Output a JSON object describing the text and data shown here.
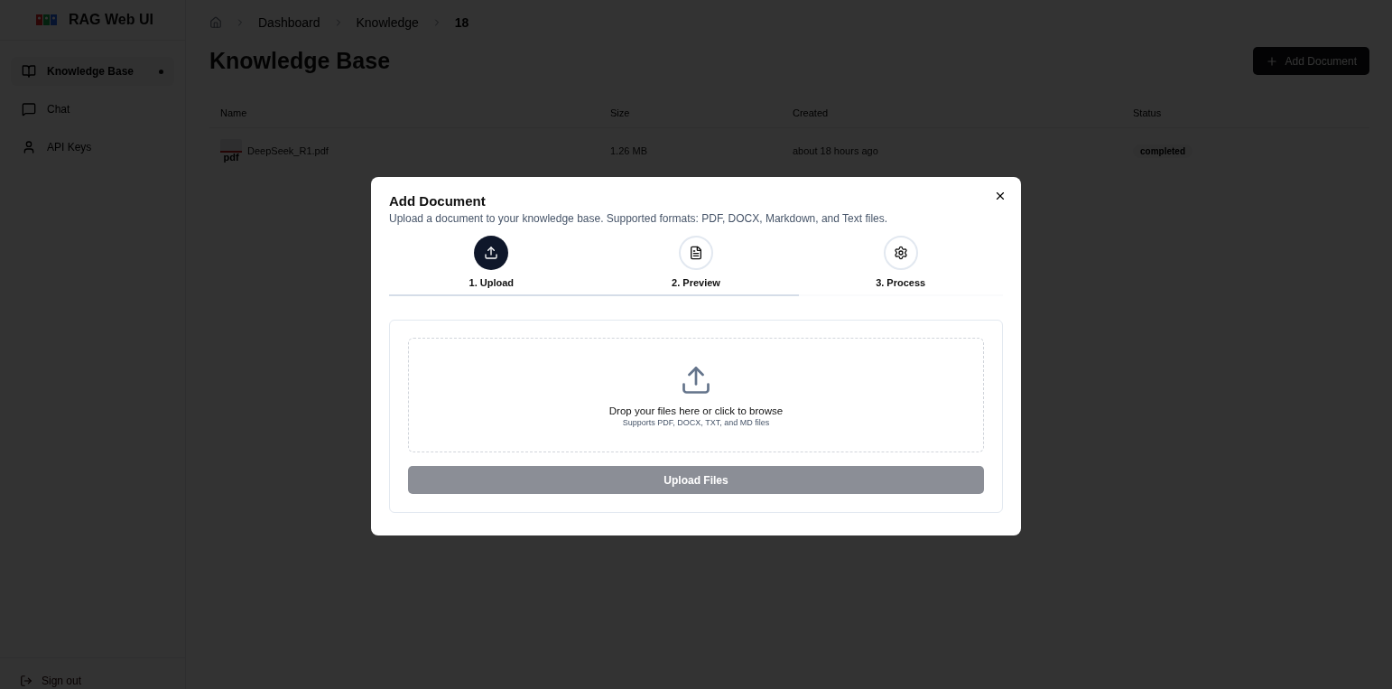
{
  "app": {
    "title": "RAG Web UI"
  },
  "sidebar": {
    "items": [
      {
        "label": "Knowledge Base",
        "selected": true
      },
      {
        "label": "Chat",
        "selected": false
      },
      {
        "label": "API Keys",
        "selected": false
      }
    ],
    "sign_out": "Sign out"
  },
  "breadcrumb": [
    {
      "label": "Dashboard",
      "current": false
    },
    {
      "label": "Knowledge",
      "current": false
    },
    {
      "label": "18",
      "current": true
    }
  ],
  "page": {
    "title": "Knowledge Base",
    "add_button": "Add Document"
  },
  "table": {
    "columns": [
      "Name",
      "Size",
      "Created",
      "Status"
    ],
    "rows": [
      {
        "name": "DeepSeek_R1.pdf",
        "file_badge": "pdf",
        "size": "1.26 MB",
        "created": "about 18 hours ago",
        "status": "completed"
      }
    ]
  },
  "dialog": {
    "title": "Add Document",
    "description": "Upload a document to your knowledge base. Supported formats: PDF, DOCX, Markdown, and Text files.",
    "steps": [
      {
        "label": "1. Upload",
        "selected": true
      },
      {
        "label": "2. Preview",
        "selected": false
      },
      {
        "label": "3. Process",
        "selected": false
      }
    ],
    "progress": {
      "level": 0.667
    },
    "dropzone": {
      "title": "Drop your files here or click to browse",
      "hint": "Supports PDF, DOCX, TXT, and MD files"
    },
    "upload_button": {
      "label": "Upload Files",
      "disabled": true
    }
  }
}
